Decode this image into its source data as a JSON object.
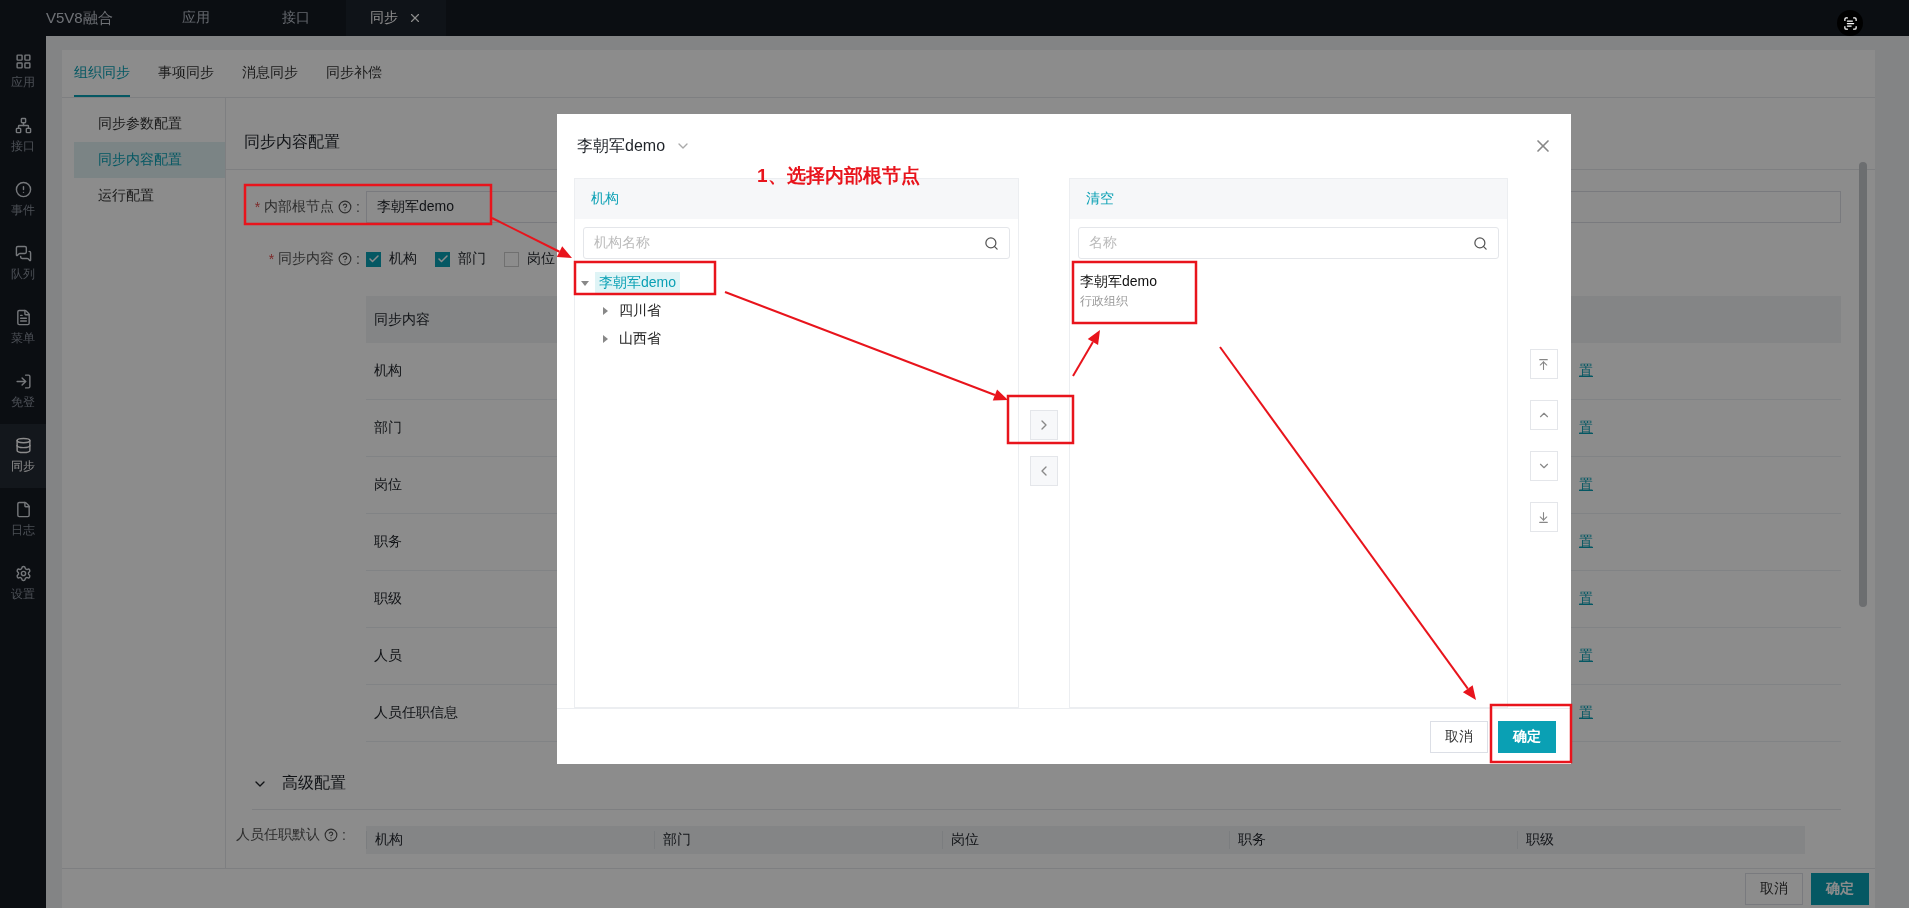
{
  "top_bar": {
    "brand": "V5V8融合",
    "tabs": [
      {
        "label": "应用",
        "selected": false,
        "closable": false
      },
      {
        "label": "接口",
        "selected": false,
        "closable": false
      },
      {
        "label": "同步",
        "selected": true,
        "closable": true
      }
    ]
  },
  "side_nav": [
    {
      "label": "应用",
      "selected": false
    },
    {
      "label": "接口",
      "selected": false
    },
    {
      "label": "事件",
      "selected": false
    },
    {
      "label": "队列",
      "selected": false
    },
    {
      "label": "菜单",
      "selected": false
    },
    {
      "label": "免登",
      "selected": false
    },
    {
      "label": "同步",
      "selected": true
    },
    {
      "label": "日志",
      "selected": false
    },
    {
      "label": "设置",
      "selected": false
    }
  ],
  "page": {
    "tabs": [
      {
        "label": "组织同步",
        "selected": true
      },
      {
        "label": "事项同步",
        "selected": false
      },
      {
        "label": "消息同步",
        "selected": false
      },
      {
        "label": "同步补偿",
        "selected": false
      }
    ],
    "menu": [
      {
        "label": "同步参数配置",
        "selected": false
      },
      {
        "label": "同步内容配置",
        "selected": true
      },
      {
        "label": "运行配置",
        "selected": false
      }
    ],
    "section_title": "同步内容配置",
    "root_field": {
      "required_mark": "*",
      "label": "内部根节点",
      "suffix": ":",
      "value": "李朝军demo"
    },
    "content_field": {
      "required_mark": "*",
      "label": "同步内容",
      "suffix": ":",
      "options": [
        {
          "label": "机构",
          "checked": true
        },
        {
          "label": "部门",
          "checked": true
        },
        {
          "label": "岗位",
          "checked": false
        }
      ]
    },
    "table": {
      "columns": [
        "同步内容"
      ],
      "rows": [
        {
          "name": "机构",
          "action": "置"
        },
        {
          "name": "部门",
          "action": "置"
        },
        {
          "name": "岗位",
          "action": "置"
        },
        {
          "name": "职务",
          "action": "置"
        },
        {
          "name": "职级",
          "action": "置"
        },
        {
          "name": "人员",
          "action": "置"
        },
        {
          "name": "人员任职信息",
          "action": "置"
        }
      ]
    },
    "advanced": {
      "title": "高级配置",
      "expanded": true,
      "field_label": "人员任职默认",
      "suffix": ":",
      "columns": [
        "机构",
        "部门",
        "岗位",
        "职务",
        "职级"
      ]
    },
    "footer": {
      "buttons": [
        {
          "label": "取消",
          "kind": "default"
        },
        {
          "label": "确定",
          "kind": "primary"
        }
      ]
    }
  },
  "dialog": {
    "title": "李朝军demo",
    "left_panel": {
      "title": "机构",
      "search_placeholder": "机构名称",
      "tree": [
        {
          "label": "李朝军demo",
          "expanded": true,
          "selected": true,
          "children": [
            {
              "label": "四川省",
              "expanded": false,
              "selected": false
            },
            {
              "label": "山西省",
              "expanded": false,
              "selected": false
            }
          ]
        }
      ]
    },
    "right_panel": {
      "title": "清空",
      "search_placeholder": "名称",
      "items": [
        {
          "name": "李朝军demo",
          "type": "行政组织"
        }
      ]
    },
    "buttons": [
      {
        "label": "取消",
        "kind": "default"
      },
      {
        "label": "确定",
        "kind": "primary"
      }
    ]
  },
  "annotation": {
    "label": "1、选择内部根节点"
  }
}
